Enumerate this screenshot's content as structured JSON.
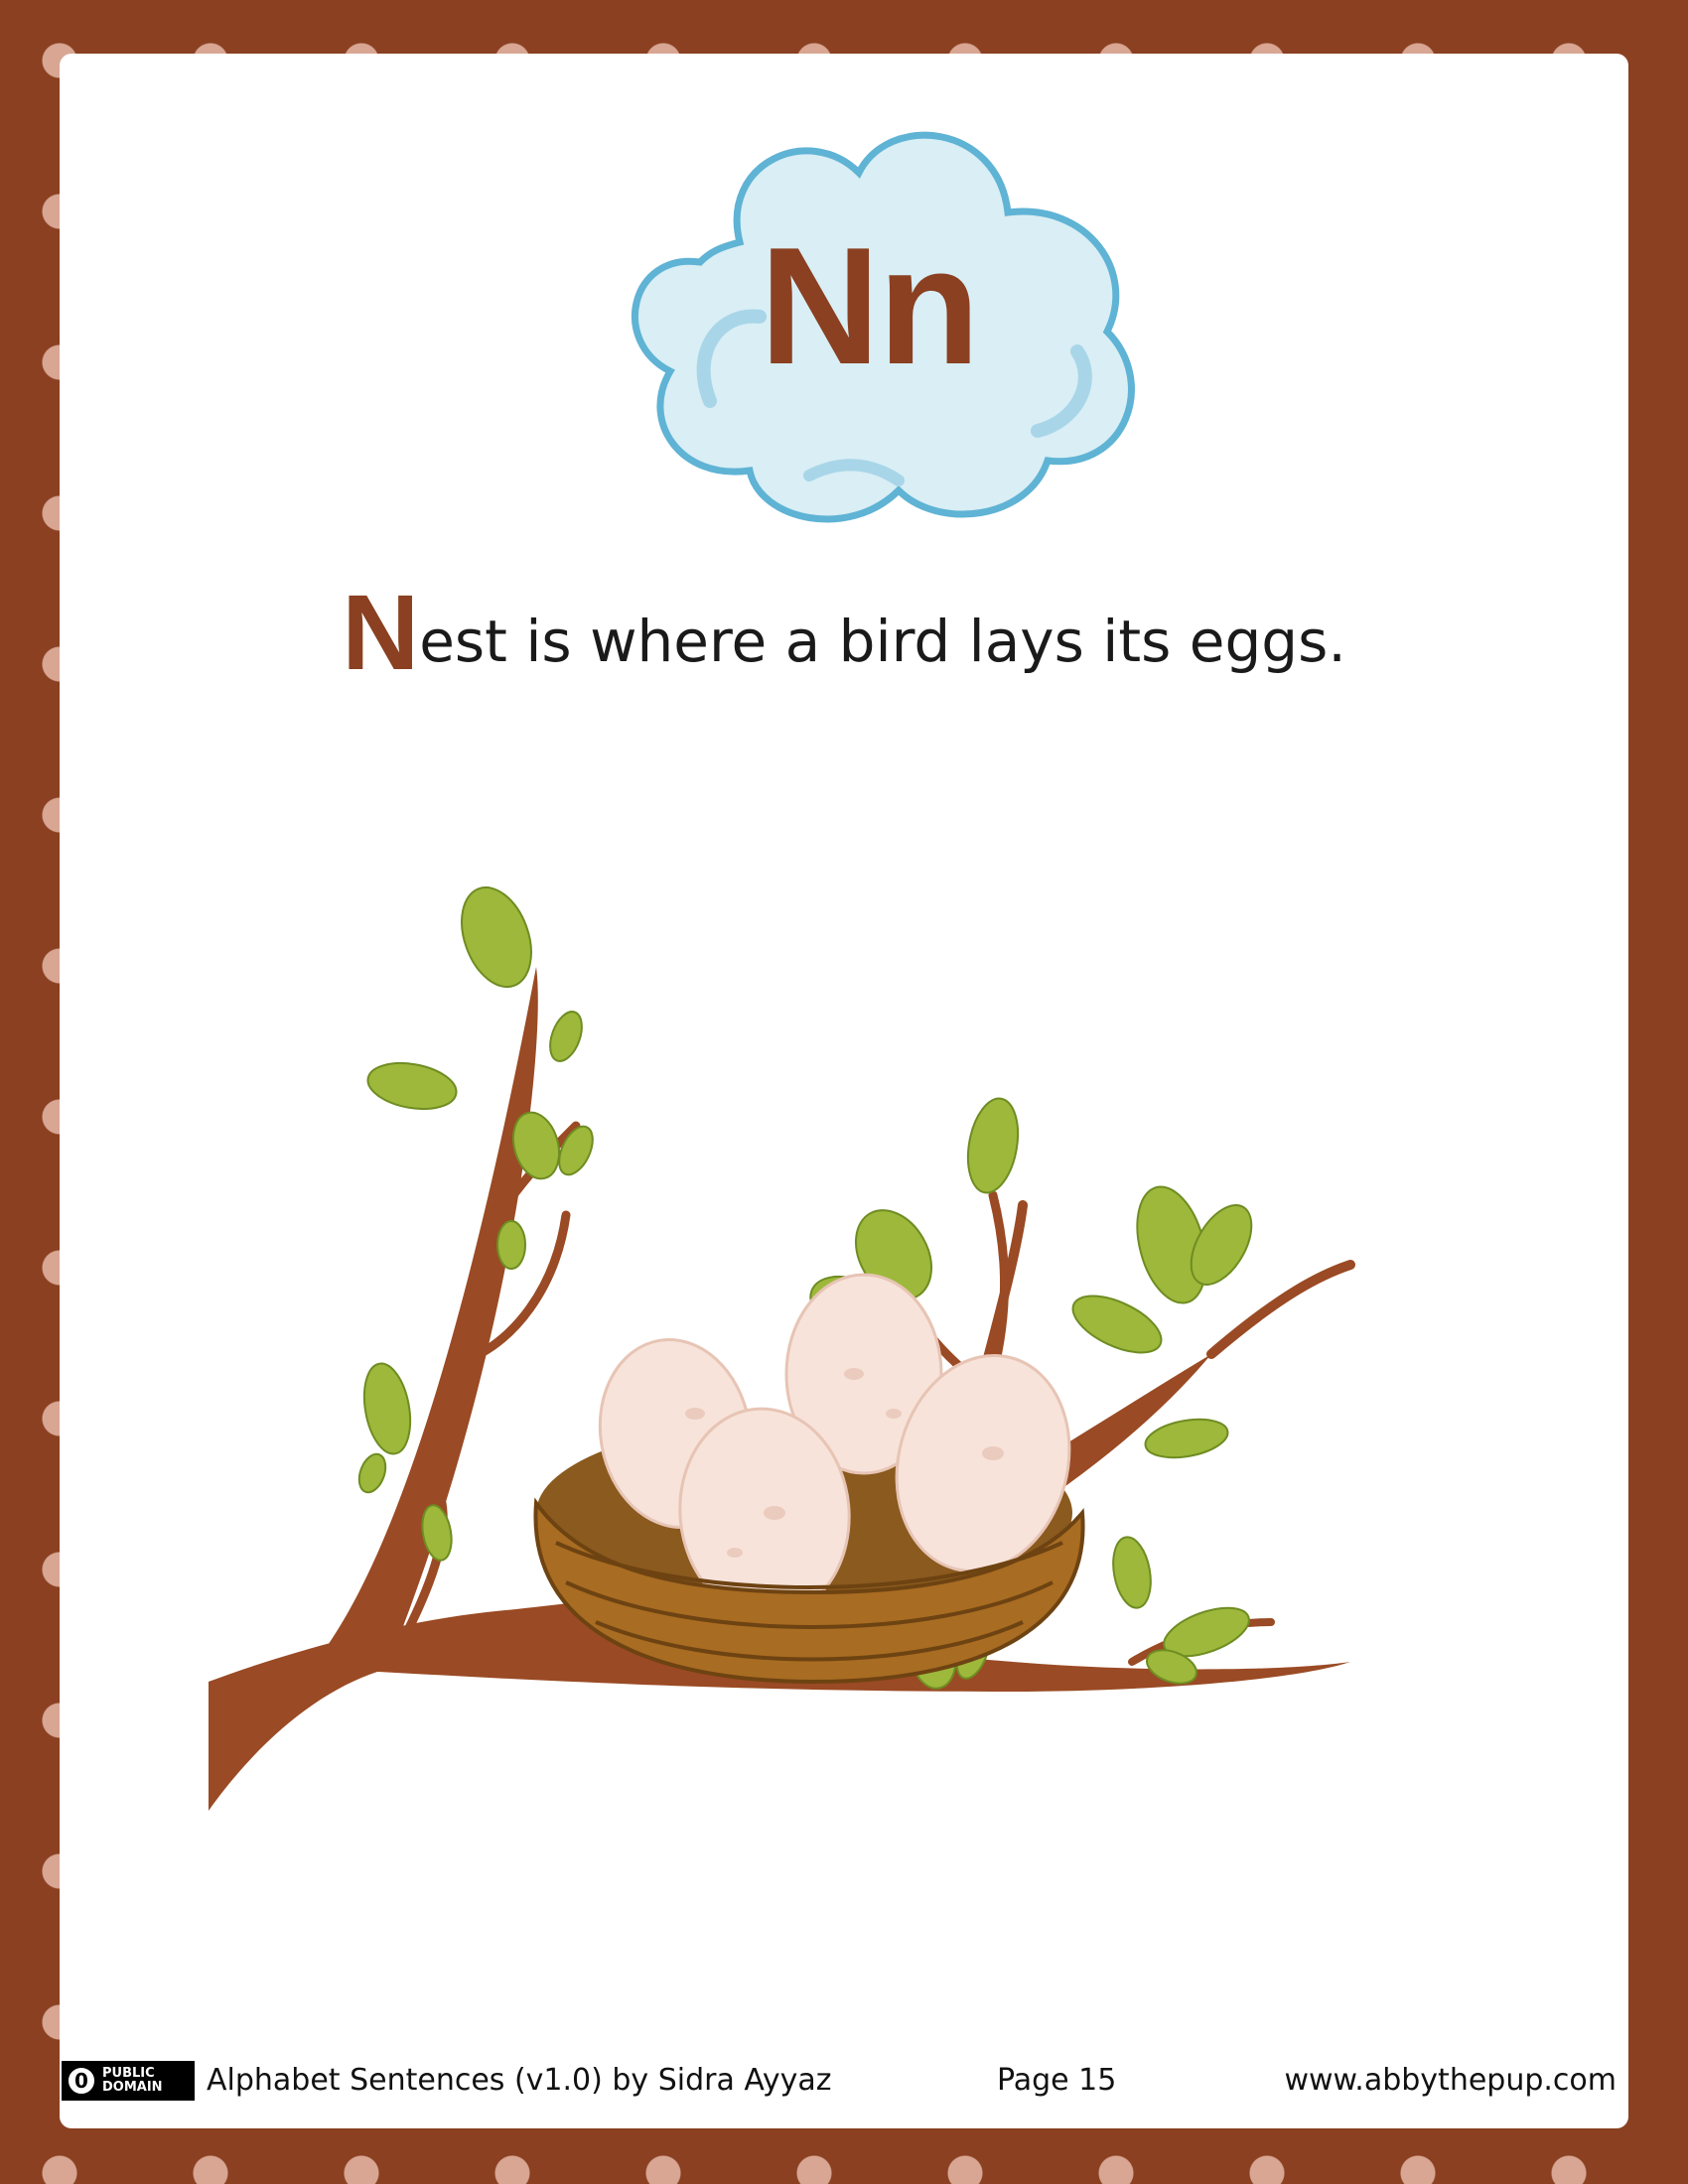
{
  "letter": "Nn",
  "sentence": {
    "initial": "N",
    "rest": "est is where a bird lays its eggs."
  },
  "illustration": {
    "icon": "nest-with-eggs-on-branch-illustration",
    "egg_count": 4
  },
  "footer": {
    "badge_symbol": "0",
    "badge_line1": "PUBLIC",
    "badge_line2": "DOMAIN",
    "credit": "Alphabet Sentences (v1.0) by Sidra Ayyaz",
    "page": "Page 15",
    "website": "www.abbythepup.com"
  },
  "colors": {
    "frame": "#8a4021",
    "dots": "#d8a693",
    "letter": "#8a4021",
    "cloud": "#d9eef5",
    "cloud_outline": "#5fb3d4",
    "leaf": "#9db83a",
    "egg": "#f7e3da"
  }
}
